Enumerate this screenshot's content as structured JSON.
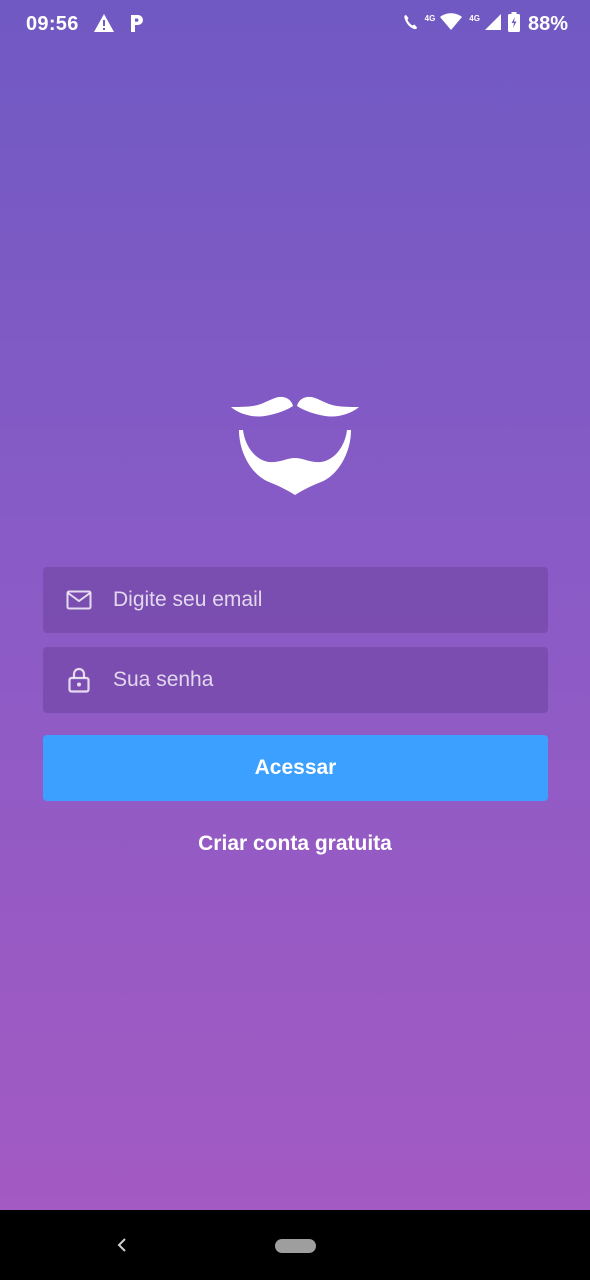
{
  "status_bar": {
    "time": "09:56",
    "network_label_1": "4G",
    "network_label_2": "4G",
    "battery_percent": "88%",
    "icons": [
      "warning-icon",
      "parking-icon",
      "volte-call-icon",
      "wifi-icon",
      "signal-icon",
      "battery-charging-icon"
    ]
  },
  "logo": {
    "icon": "mustache-beard-logo",
    "color": "#FFFFFF"
  },
  "login_form": {
    "email": {
      "icon": "mail-icon",
      "placeholder": "Digite seu email",
      "value": ""
    },
    "password": {
      "icon": "lock-icon",
      "placeholder": "Sua senha",
      "value": ""
    },
    "submit_label": "Acessar",
    "create_account_label": "Criar conta gratuita"
  },
  "colors": {
    "gradient_top": "#7059C3",
    "gradient_bottom": "#A65AC2",
    "button": "#3BA0FF",
    "text": "#FFFFFF"
  },
  "nav_bar": {
    "icons": [
      "back-icon",
      "home-pill-icon"
    ]
  }
}
